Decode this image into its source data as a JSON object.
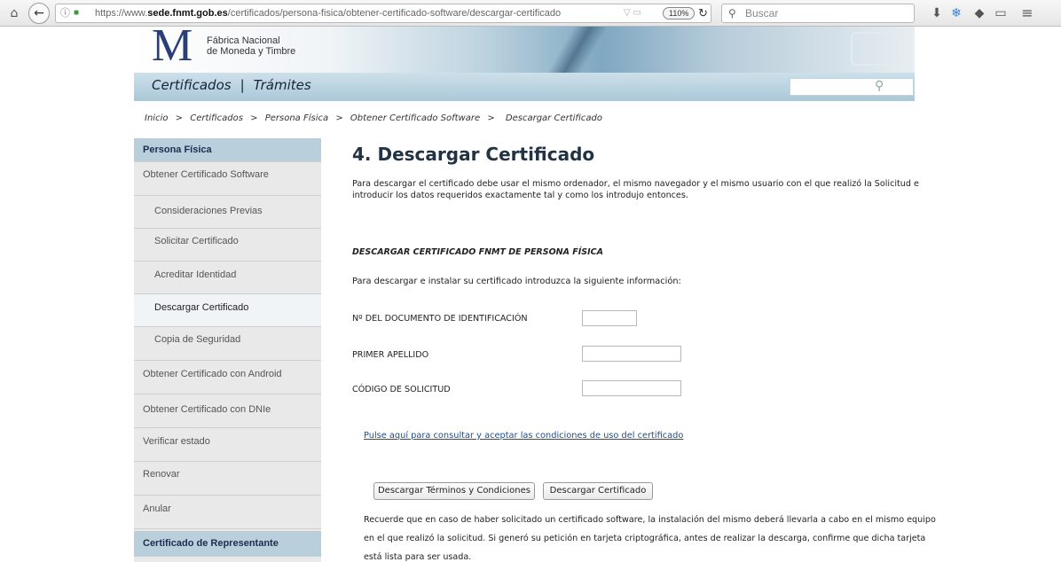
{
  "browser": {
    "url_prefix": "https://www.",
    "url_domain": "sede.fnmt.gob.es",
    "url_path": "/certificados/persona-fisica/obtener-certificado-software/descargar-certificado",
    "zoom": "110%",
    "search_placeholder": "Buscar"
  },
  "header": {
    "logo_letter": "M",
    "logo_line1": "Fábrica Nacional",
    "logo_line2": "de Moneda y Timbre",
    "nav_certificados": "Certificados",
    "nav_separator": "|",
    "nav_tramites": "Trámites"
  },
  "breadcrumb": [
    "Inicio",
    ">",
    "Certificados",
    ">",
    "Persona Física",
    ">",
    "Obtener Certificado Software",
    ">",
    "Descargar Certificado"
  ],
  "sidebar": {
    "items": [
      {
        "label": "Persona Física"
      },
      {
        "label": "Obtener Certificado Software"
      },
      {
        "label": "Consideraciones Previas"
      },
      {
        "label": "Solicitar Certificado"
      },
      {
        "label": "Acreditar Identidad"
      },
      {
        "label": "Descargar Certificado"
      },
      {
        "label": "Copia de Seguridad"
      },
      {
        "label": "Obtener Certificado con Android"
      },
      {
        "label": "Obtener Certificado con DNIe"
      },
      {
        "label": "Verificar estado"
      },
      {
        "label": "Renovar"
      },
      {
        "label": "Anular"
      },
      {
        "label": "Certificado de Representante"
      }
    ]
  },
  "main": {
    "title": "4. Descargar Certificado",
    "intro": "Para descargar el certificado debe usar el mismo ordenador, el mismo navegador y el mismo usuario con el que realizó la Solicitud e introducir los datos requeridos exactamente tal y como los introdujo entonces.",
    "form_heading": "DESCARGAR CERTIFICADO FNMT DE PERSONA FÍSICA",
    "form_instruction": "Para descargar e instalar su certificado introduzca la siguiente información:",
    "field_document": "Nº DEL DOCUMENTO DE IDENTIFICACIÓN",
    "field_apellido": "PRIMER APELLIDO",
    "field_codigo": "CÓDIGO DE SOLICITUD",
    "conditions_link": "Pulse aquí para consultar y aceptar las condiciones de uso del certificado",
    "btn_terms": "Descargar Términos y Condiciones",
    "btn_download": "Descargar Certificado",
    "notice": "Recuerde que en caso de haber solicitado un certificado software, la instalación del mismo deberá llevarla a cabo en el mismo equipo en el que realizó la solicitud. Si generó su petición en tarjeta criptográfica, antes de realizar la descarga, confirme que dicha tarjeta está lista para ser usada."
  }
}
